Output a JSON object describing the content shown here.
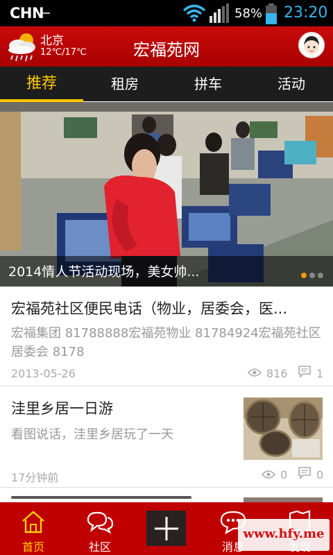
{
  "status_bar": {
    "carrier": "CHN",
    "battery_percent": "58%",
    "time": "23:20",
    "icons": [
      "wifi-icon",
      "signal-icon",
      "battery-icon"
    ]
  },
  "header": {
    "city": "北京",
    "temperature": "12℃/17℃",
    "title": "宏福苑网",
    "weather_icon": "cloud-rain-sun-icon",
    "avatar_icon": "user-avatar-icon"
  },
  "tabs": [
    {
      "label": "推荐",
      "active": true
    },
    {
      "label": "租房",
      "active": false
    },
    {
      "label": "拼车",
      "active": false
    },
    {
      "label": "活动",
      "active": false
    }
  ],
  "banner": {
    "caption": "2014情人节活动现场，美女帅...",
    "slide_count": 3,
    "active_slide": 1
  },
  "feed": [
    {
      "title": "宏福苑社区便民电话（物业，居委会，医...",
      "description": "宏福集团 81788888宏福苑物业 81784924宏福苑社区居委会 8178",
      "date": "2013-05-26",
      "views": "816",
      "comments": "1"
    },
    {
      "title": "洼里乡居一日游",
      "description": "看图说话，洼里乡居玩了一天",
      "date": "17分钟前",
      "views": "0",
      "comments": "0"
    }
  ],
  "bottom_nav": [
    {
      "label": "首页",
      "icon": "home-icon",
      "active": true
    },
    {
      "label": "社区",
      "icon": "chat-bubbles-icon",
      "active": false
    },
    {
      "label": "",
      "icon": "plus-icon",
      "active": false
    },
    {
      "label": "消息",
      "icon": "message-icon",
      "active": false
    },
    {
      "label": "发现",
      "icon": "discover-icon",
      "active": false
    }
  ],
  "watermark": "www.hfy.me",
  "colors": {
    "brand_red": "#c00000",
    "tab_accent": "#ffc800",
    "time_blue": "#39b4ea"
  }
}
